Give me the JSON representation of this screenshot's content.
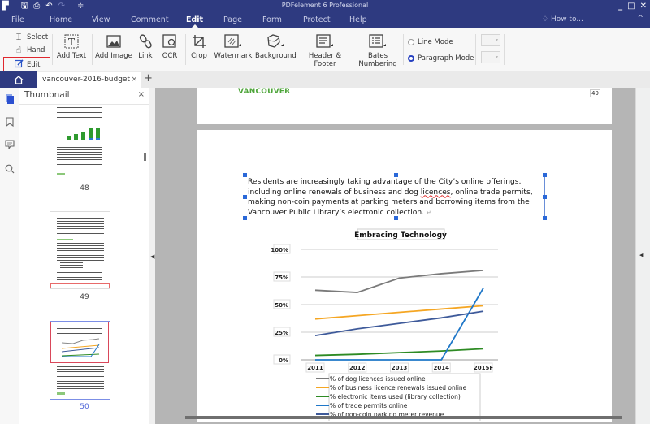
{
  "app": {
    "title": "PDFelement 6 Professional",
    "quick_access": [
      "app-menu-icon",
      "save-icon",
      "print-icon",
      "undo-icon",
      "redo-icon",
      "customize-icon"
    ],
    "window_controls": {
      "minimize": "_",
      "maximize": "□",
      "close": "✕"
    }
  },
  "menu": {
    "tabs": [
      {
        "label": "File"
      },
      {
        "label": "Home"
      },
      {
        "label": "View"
      },
      {
        "label": "Comment"
      },
      {
        "label": "Edit",
        "active": true
      },
      {
        "label": "Page"
      },
      {
        "label": "Form"
      },
      {
        "label": "Protect"
      },
      {
        "label": "Help"
      }
    ],
    "how_to": "How to...",
    "collapse": "^"
  },
  "ribbon": {
    "select": "Select",
    "hand": "Hand",
    "edit": "Edit",
    "add_text": "Add Text",
    "add_image": "Add Image",
    "link": "Link",
    "ocr": "OCR",
    "crop": "Crop",
    "watermark": "Watermark",
    "background": "Background",
    "header_footer": "Header & Footer",
    "bates_1": "Bates",
    "bates_2": "Numbering",
    "line_mode": "Line Mode",
    "paragraph_mode": "Paragraph Mode",
    "mode_selected": "Paragraph Mode"
  },
  "tabs": {
    "document": "vancouver-2016-budget",
    "close": "×",
    "new": "+"
  },
  "thumbnail_panel": {
    "title": "Thumbnail",
    "close": "×",
    "pages": [
      {
        "number": "48"
      },
      {
        "number": "49"
      },
      {
        "number": "50",
        "current": true
      }
    ]
  },
  "document": {
    "prev_page": {
      "logo_text": "VANCOUVER",
      "page_number": "49"
    },
    "paragraph": {
      "before": "Residents are increasingly taking advantage of the City’s online offerings, including online renewals of business and dog ",
      "misspelled": "licences",
      "after": ", online trade permits, making non-coin payments at parking meters and borrowing items from the Vancouver Public Library’s electronic collection.",
      "pilcrow": "↵"
    }
  },
  "chart_data": {
    "type": "line",
    "title": "Embracing Technology",
    "categories": [
      "2011",
      "2012",
      "2013",
      "2014",
      "2015F"
    ],
    "y_ticks": [
      "0%",
      "25%",
      "50%",
      "75%",
      "100%"
    ],
    "ylim": [
      0,
      100
    ],
    "grid": true,
    "legend_position": "bottom",
    "series": [
      {
        "name": "% of dog licences issued online",
        "color": "#7a7a7a",
        "values": [
          63,
          61,
          74,
          78,
          81
        ]
      },
      {
        "name": "% of business licence renewals issued online",
        "color": "#f5a623",
        "values": [
          37,
          40,
          43,
          46,
          49
        ]
      },
      {
        "name": "% electronic items used (library collection)",
        "color": "#2e8b24",
        "values": [
          4,
          5,
          6.5,
          8,
          10
        ]
      },
      {
        "name": "% of trade permits online",
        "color": "#1f77c8",
        "values": [
          0,
          0,
          0,
          0,
          65
        ]
      },
      {
        "name": "% of non-coin parking meter revenue",
        "color": "#3e5a9a",
        "values": [
          22,
          28,
          33,
          38,
          44
        ]
      }
    ]
  }
}
